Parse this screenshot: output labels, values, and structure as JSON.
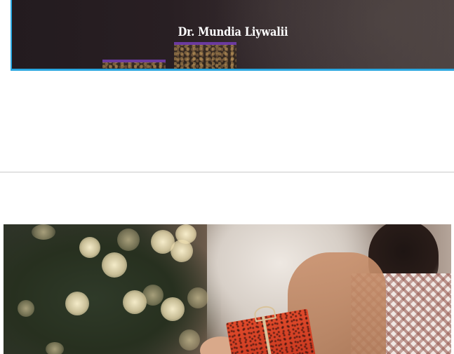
{
  "hero": {
    "title": "Dr. Mundia Liywalii",
    "border_color": "#2aa7e0",
    "thumbnail_accent_color": "#6b3aa0"
  },
  "photo": {
    "subject": "christmas-gift-image"
  }
}
